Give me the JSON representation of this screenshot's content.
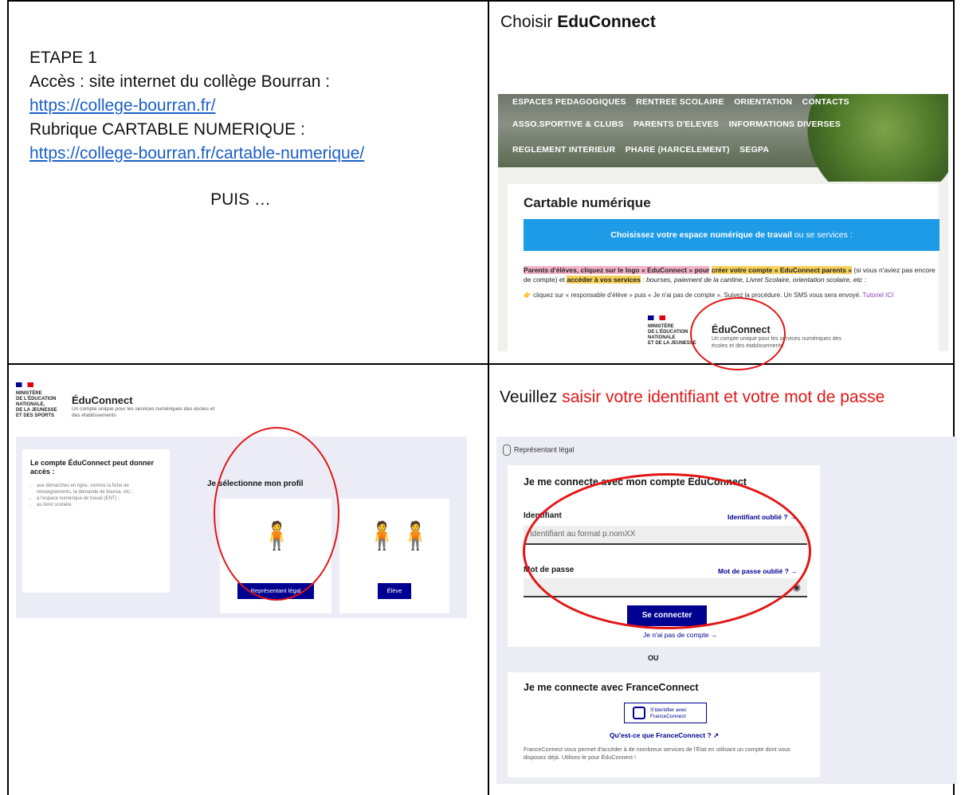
{
  "step1": {
    "etape": "ETAPE 1",
    "acces": "Accès : site internet du collège Bourran :",
    "url1": "https://college-bourran.fr/",
    "rubrique": "Rubrique CARTABLE NUMERIQUE :",
    "url2": "https://college-bourran.fr/cartable-numerique/",
    "puis": "PUIS …"
  },
  "step2": {
    "title_prefix": "Choisir ",
    "title_bold": "EduConnect",
    "site": {
      "nav1": [
        "ESPACES PEDAGOGIQUES",
        "RENTREE SCOLAIRE",
        "ORIENTATION",
        "CONTACTS"
      ],
      "nav2": [
        "ASSO.SPORTIVE & CLUBS",
        "PARENTS D'ELEVES",
        "INFORMATIONS DIVERSES"
      ],
      "nav3": [
        "REGLEMENT INTERIEUR",
        "PHARE (HARCELEMENT)",
        "SEGPA"
      ],
      "heading": "Cartable numérique",
      "banner_bold": "Choisissez votre espace numérique de travail",
      "banner_rest": " ou se services :",
      "para_pink": "Parents d'élèves, cliquez sur le logo « EduConnect » pour",
      "para_yellow1": "créer votre compte « EduConnect parents »",
      "para_mid": " (si vous n'aviez pas encore de compte) et ",
      "para_yellow2": "accéder à vos services",
      "para_end": " : bourses, paiement de la cantine, Livret Scolaire, orientation scolaire, etc :",
      "instr": "👉 cliquez sur « responsable d'élève » puis « Je n'ai pas de compte ». Suivez la procédure. Un SMS vous sera envoyé. ",
      "tutoriel": "Tutoriel ICI",
      "ministere": "MINISTÈRE\nDE L'ÉDUCATION\nNATIONALE\nET DE LA JEUNESSE",
      "educonnect": "ÉduConnect",
      "educonnect_sub": "Un compte unique pour les services numériques des écoles et des établissements"
    }
  },
  "step3": {
    "ministere": "MINISTÈRE\nDE L'ÉDUCATION\nNATIONALE,\nDE LA JEUNESSE\nET DES SPORTS",
    "educonnect": "ÉduConnect",
    "educonnect_sub": "Un compte unique pour les services numériques des écoles et des établissements",
    "left_title": "Le compte ÉduConnect peut donner accès :",
    "left_items": [
      "aux démarches en ligne, comme la fiche de renseignements, la demande de bourse, etc ;",
      "à l'espace numérique de travail (ENT) ;",
      "au livret scolaire."
    ],
    "select_label": "Je sélectionne mon profil",
    "btn_legal": "Représentant légal",
    "btn_eleve": "Élève"
  },
  "step4": {
    "instr_prefix": "Veuillez ",
    "instr_red": "saisir votre identifiant et votre  mot de passe",
    "rep_legal": "Représentant légal",
    "login_heading": "Je me connecte avec mon compte ÉduConnect",
    "identifiant_label": "Identifiant",
    "identifiant_forgot": "Identifiant oublié ? →",
    "identifiant_placeholder": "Identifiant au format p.nomXX",
    "password_label": "Mot de passe",
    "password_forgot": "Mot de passe oublié ? →",
    "connect_button": "Se connecter",
    "no_account": "Je n'ai pas de compte →",
    "ou": "OU",
    "fc_heading": "Je me connecte avec FranceConnect",
    "fc_button": "S'identifier avec\nFranceConnect",
    "fc_question": "Qu'est-ce que FranceConnect ? ↗",
    "fc_text": "FranceConnect vous permet d'accéder à de nombreux services de l'État en utilisant un compte dont vous disposez déjà. Utilisez-le pour ÉduConnect !"
  },
  "colors": {
    "link_blue": "#1a5fc8",
    "red": "#e31616",
    "banner_blue": "#1e9be6",
    "gov_blue": "#000091"
  }
}
